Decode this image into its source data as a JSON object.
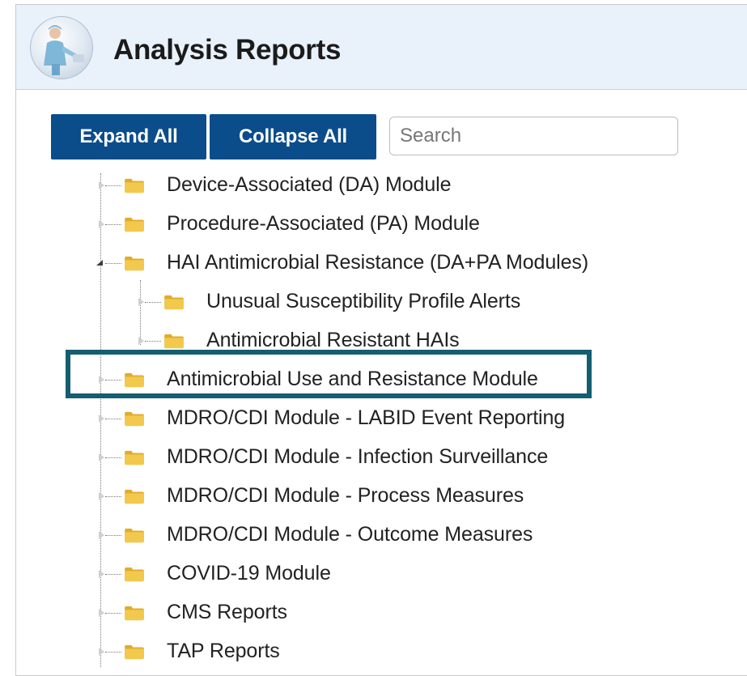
{
  "header": {
    "title": "Analysis Reports"
  },
  "toolbar": {
    "expand_label": "Expand All",
    "collapse_label": "Collapse All",
    "search_placeholder": "Search"
  },
  "tree": {
    "items": [
      {
        "label": "Device-Associated (DA) Module"
      },
      {
        "label": "Procedure-Associated (PA) Module"
      },
      {
        "label": "HAI Antimicrobial Resistance (DA+PA Modules)",
        "expanded": true,
        "children": [
          {
            "label": "Unusual Susceptibility Profile Alerts"
          },
          {
            "label": "Antimicrobial Resistant HAIs"
          }
        ]
      },
      {
        "label": "Antimicrobial Use and Resistance Module",
        "highlighted": true
      },
      {
        "label": "MDRO/CDI Module - LABID Event Reporting"
      },
      {
        "label": "MDRO/CDI Module - Infection Surveillance"
      },
      {
        "label": "MDRO/CDI Module - Process Measures"
      },
      {
        "label": "MDRO/CDI Module - Outcome Measures"
      },
      {
        "label": "COVID-19 Module"
      },
      {
        "label": "CMS Reports"
      },
      {
        "label": "TAP Reports"
      }
    ]
  },
  "colors": {
    "button_bg": "#0b4d8b",
    "header_bg": "#e9f1fb",
    "highlight_border": "#135e70",
    "folder": "#f2c94c"
  },
  "icons": {
    "avatar": "clinician-avatar-icon",
    "folder": "folder-icon",
    "collapsed_toggle": "triangle-right-icon",
    "expanded_toggle": "triangle-down-icon"
  }
}
